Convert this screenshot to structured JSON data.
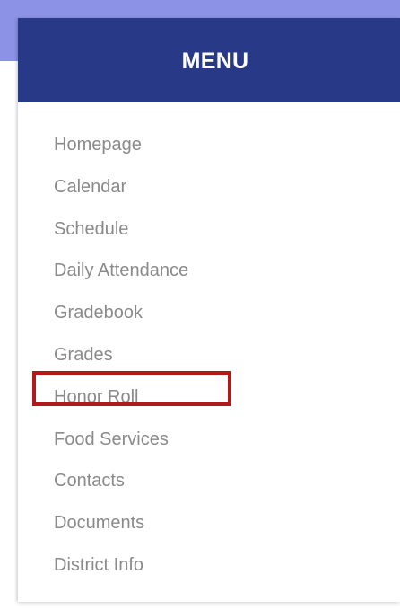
{
  "colors": {
    "top_band": "#8c93e6",
    "header_bg": "#283a87",
    "header_text": "#ffffff",
    "item_text": "#8a8a8a",
    "highlight_border": "#b01a1a"
  },
  "menu": {
    "title": "MENU",
    "items": [
      {
        "label": "Homepage"
      },
      {
        "label": "Calendar"
      },
      {
        "label": "Schedule"
      },
      {
        "label": "Daily Attendance"
      },
      {
        "label": "Gradebook"
      },
      {
        "label": "Grades"
      },
      {
        "label": "Honor Roll"
      },
      {
        "label": "Food Services"
      },
      {
        "label": "Contacts",
        "highlighted": true
      },
      {
        "label": "Documents"
      },
      {
        "label": "District Info"
      }
    ]
  }
}
